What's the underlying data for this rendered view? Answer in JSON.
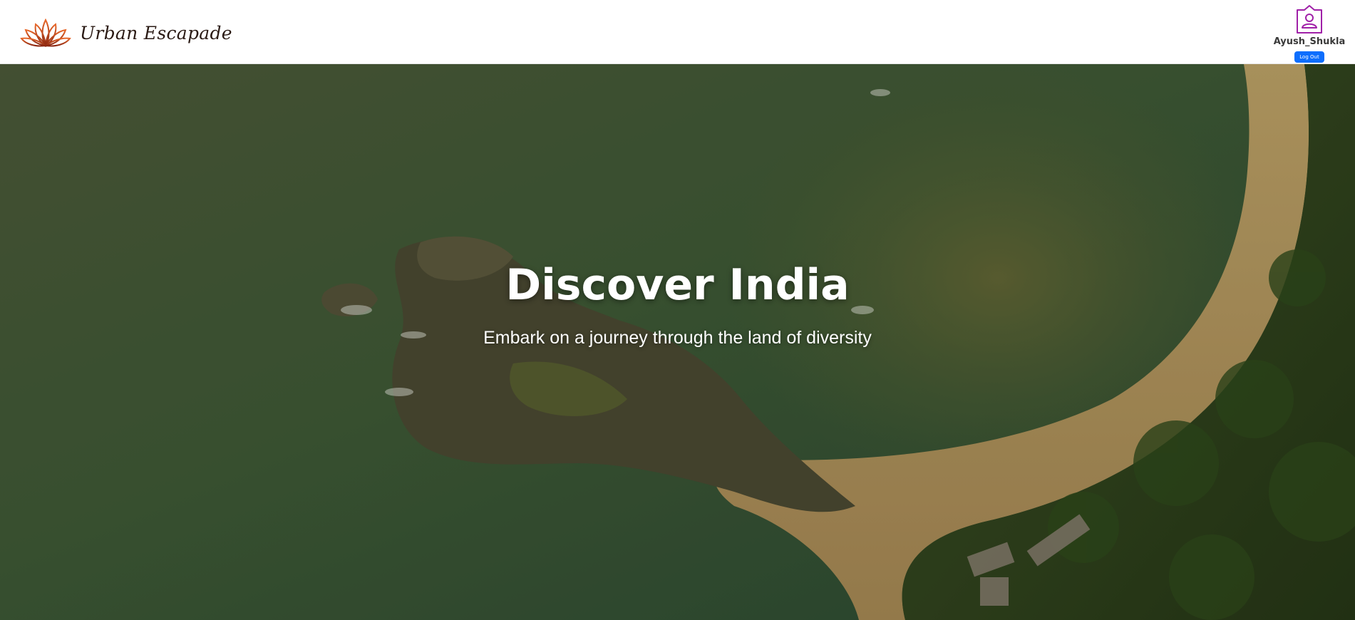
{
  "header": {
    "brand_name": "Urban Escapade",
    "logo_icon": "lotus-icon",
    "user_icon": "user-badge-icon",
    "username": "Ayush_Shukla",
    "logout_label": "Log Out"
  },
  "hero": {
    "title": "Discover India",
    "subtitle": "Embark on a journey through the land of diversity",
    "background": "aerial-coastline-image"
  },
  "colors": {
    "brand_text": "#2a1a14",
    "logo_orange": "#d2521b",
    "logo_dark": "#7a1f10",
    "user_icon": "#a020a8",
    "logout_button": "#0d6efd"
  }
}
